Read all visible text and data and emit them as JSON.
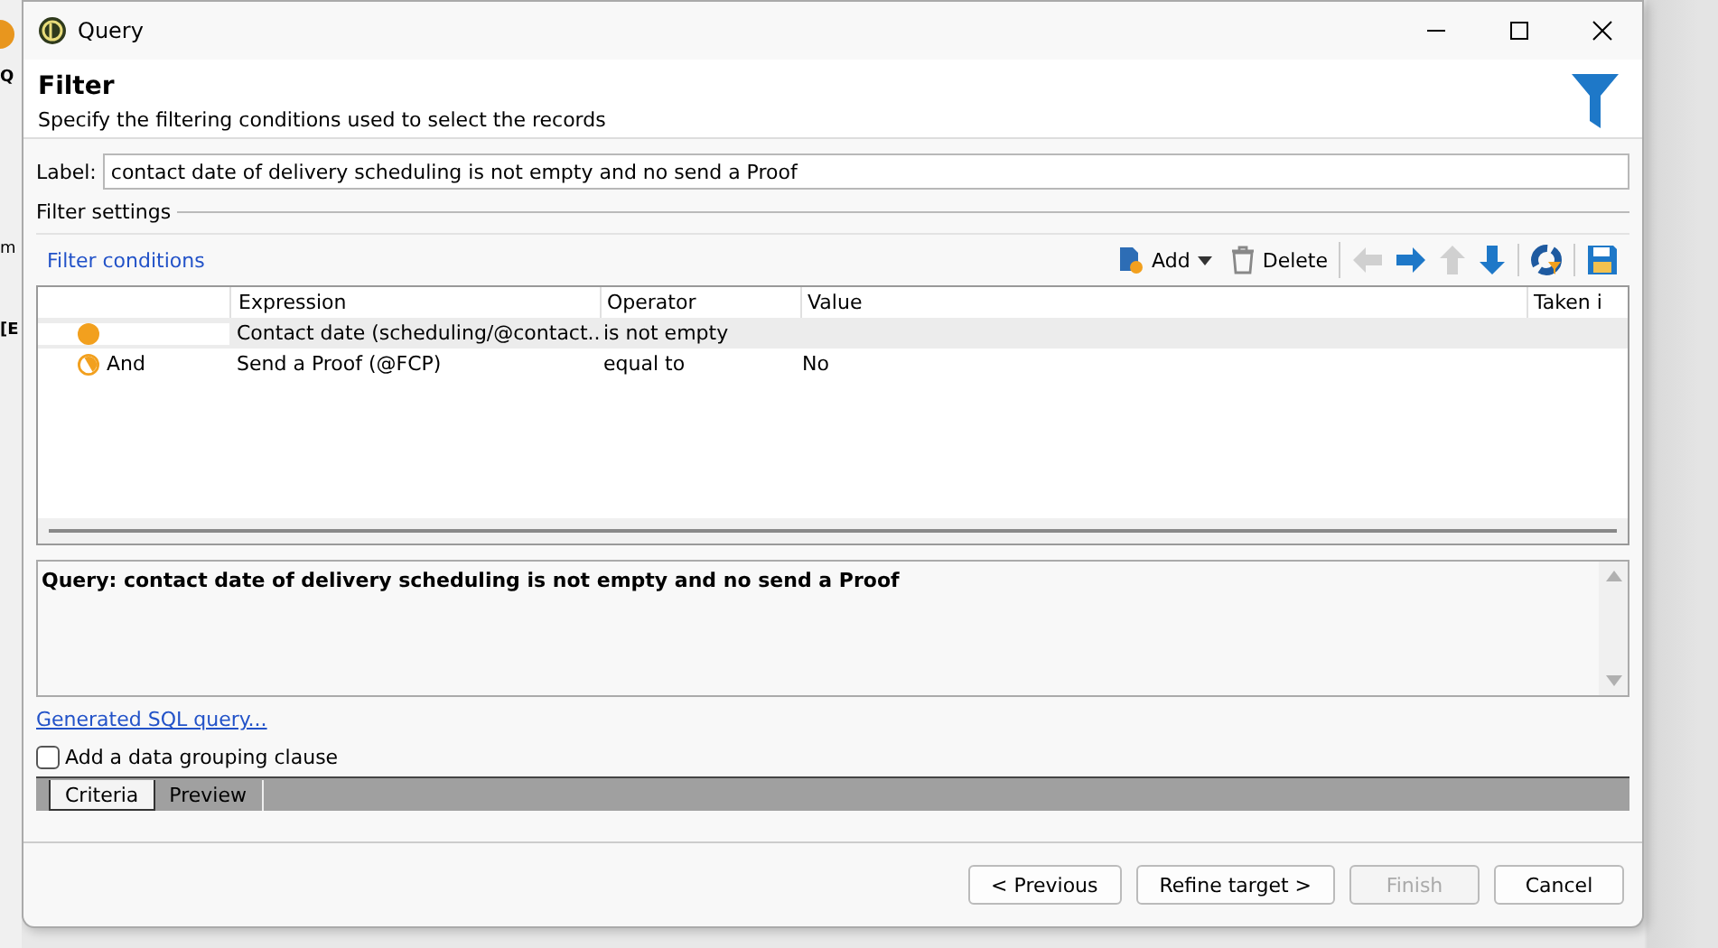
{
  "background_app": {
    "fragments": [
      "Q",
      "m",
      "[E"
    ]
  },
  "window": {
    "title": "Query"
  },
  "header": {
    "title": "Filter",
    "subtitle": "Specify the filtering conditions used to select the records"
  },
  "label_field": {
    "label": "Label:",
    "value": "contact date of delivery scheduling is not empty and no send a Proof"
  },
  "filter_settings": {
    "title": "Filter settings",
    "conditions_link": "Filter conditions",
    "toolbar": [
      {
        "kind": "add",
        "label": "Add",
        "disabled": false
      },
      {
        "kind": "delete",
        "label": "Delete",
        "disabled": false
      },
      {
        "kind": "left",
        "disabled": true
      },
      {
        "kind": "right",
        "disabled": false
      },
      {
        "kind": "up",
        "disabled": true
      },
      {
        "kind": "down",
        "disabled": false
      },
      {
        "kind": "distribution",
        "disabled": false
      },
      {
        "kind": "save",
        "disabled": false
      }
    ]
  },
  "table": {
    "columns": [
      "Expression",
      "Operator",
      "Value",
      "Taken i"
    ],
    "rows": [
      {
        "kind": "first",
        "operator_link": "",
        "expression": "Contact date (scheduling/@contact..",
        "operator": "is not empty",
        "value": "",
        "selected": true
      },
      {
        "kind": "and",
        "operator_link": "And",
        "expression": "Send a Proof (@FCP)",
        "operator": "equal to",
        "value": "No",
        "selected": false
      }
    ]
  },
  "query_text": "Query: contact date of delivery scheduling is not empty and no send a Proof",
  "sql_link": "Generated SQL query...",
  "grouping": {
    "label": "Add a data grouping clause",
    "checked": false
  },
  "tabs": [
    {
      "label": "Criteria",
      "selected": true
    },
    {
      "label": "Preview",
      "selected": false
    }
  ],
  "buttons": [
    {
      "label": "< Previous",
      "disabled": false
    },
    {
      "label": "Refine target >",
      "disabled": false
    },
    {
      "label": "Finish",
      "disabled": true
    },
    {
      "label": "Cancel",
      "disabled": false
    }
  ]
}
